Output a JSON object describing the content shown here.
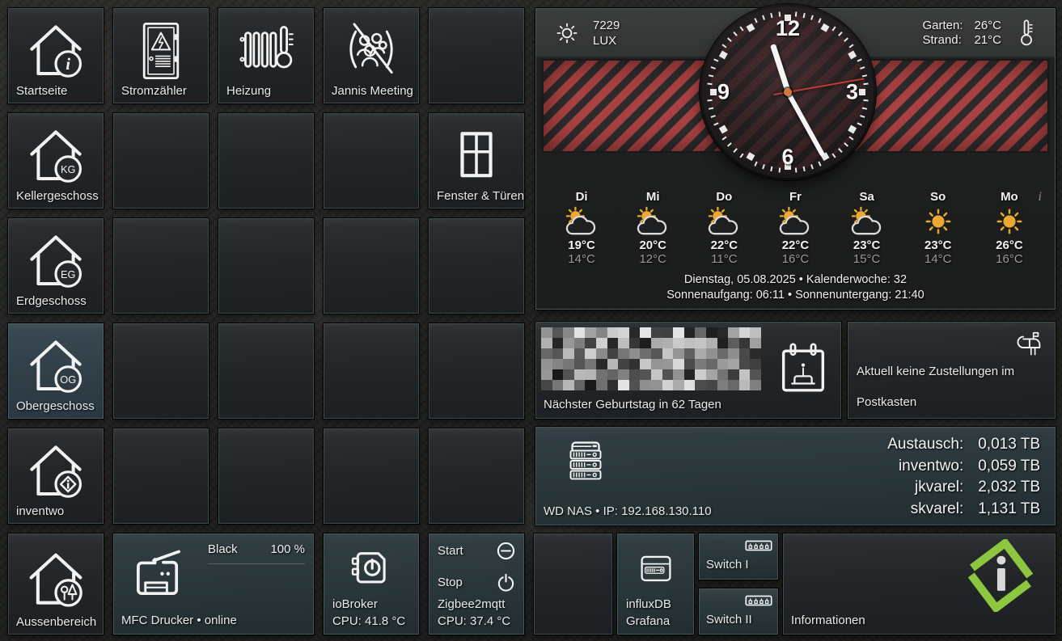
{
  "nav": {
    "tiles": [
      {
        "id": "startseite",
        "label": "Startseite"
      },
      {
        "id": "stromzaehler",
        "label": "Stromzähler"
      },
      {
        "id": "heizung",
        "label": "Heizung"
      },
      {
        "id": "jannis-meeting",
        "label": "Jannis Meeting"
      },
      {
        "id": "kellergeschoss",
        "label": "Kellergeschoss",
        "badge": "KG"
      },
      {
        "id": "fenster-tueren",
        "label": "Fenster & Türen"
      },
      {
        "id": "erdgeschoss",
        "label": "Erdgeschoss",
        "badge": "EG"
      },
      {
        "id": "obergeschoss",
        "label": "Obergeschoss",
        "badge": "OG",
        "active": true
      },
      {
        "id": "inventwo",
        "label": "inventwo"
      },
      {
        "id": "aussenbereich",
        "label": "Aussenbereich"
      }
    ]
  },
  "ambient": {
    "lux_value": "7229",
    "lux_unit": "LUX",
    "locations": [
      {
        "label": "Garten:",
        "temp": "26°C"
      },
      {
        "label": "Strand:",
        "temp": "21°C"
      }
    ]
  },
  "clock": {
    "numerals": [
      "12",
      "3",
      "6",
      "9"
    ],
    "hour_angle": 342,
    "minute_angle": 151,
    "second_angle": 80
  },
  "forecast": {
    "info_icon": "i",
    "days": [
      {
        "day": "Di",
        "high": "19°C",
        "low": "14°C",
        "icon": "sun-cloud"
      },
      {
        "day": "Mi",
        "high": "20°C",
        "low": "12°C",
        "icon": "sun-cloud"
      },
      {
        "day": "Do",
        "high": "22°C",
        "low": "11°C",
        "icon": "sun-cloud"
      },
      {
        "day": "Fr",
        "high": "22°C",
        "low": "16°C",
        "icon": "sun-cloud"
      },
      {
        "day": "Sa",
        "high": "23°C",
        "low": "15°C",
        "icon": "sun-cloud"
      },
      {
        "day": "So",
        "high": "23°C",
        "low": "14°C",
        "icon": "sun"
      },
      {
        "day": "Mo",
        "high": "26°C",
        "low": "16°C",
        "icon": "sun"
      }
    ],
    "date_line": "Dienstag, 05.08.2025 • Kalenderwoche: 32",
    "sun_line": "Sonnenaufgang: 06:11 • Sonnenuntergang: 21:40"
  },
  "birthday": {
    "caption": "Nächster Geburtstag in 62 Tagen"
  },
  "postbox": {
    "line1": "Aktuell keine Zustellungen im",
    "line2": "Postkasten"
  },
  "nas": {
    "caption": "WD NAS • IP: 192.168.130.110",
    "shares": [
      {
        "name": "Austausch:",
        "size": "0,013 TB"
      },
      {
        "name": "inventwo:",
        "size": "0,059 TB"
      },
      {
        "name": "jkvarel:",
        "size": "2,032 TB"
      },
      {
        "name": "skvarel:",
        "size": "1,131 TB"
      }
    ]
  },
  "printer": {
    "toner_label": "Black",
    "toner_level": "100 %",
    "caption": "MFC Drucker • online"
  },
  "iobroker": {
    "name": "ioBroker",
    "cpu": "CPU: 41.8 °C"
  },
  "zigbee": {
    "start_label": "Start",
    "stop_label": "Stop",
    "name": "Zigbee2mqtt",
    "cpu": "CPU: 37.4 °C"
  },
  "influx": {
    "line1": "influxDB",
    "line2": "Grafana"
  },
  "switches": [
    {
      "label": "Switch I"
    },
    {
      "label": "Switch II"
    }
  ],
  "info_tile": {
    "label": "Informationen"
  },
  "colors": {
    "accent_green": "#8dc63f",
    "stripe_red": "#a84141",
    "sun_orange": "#eba832",
    "second_hand": "#c23b34"
  }
}
